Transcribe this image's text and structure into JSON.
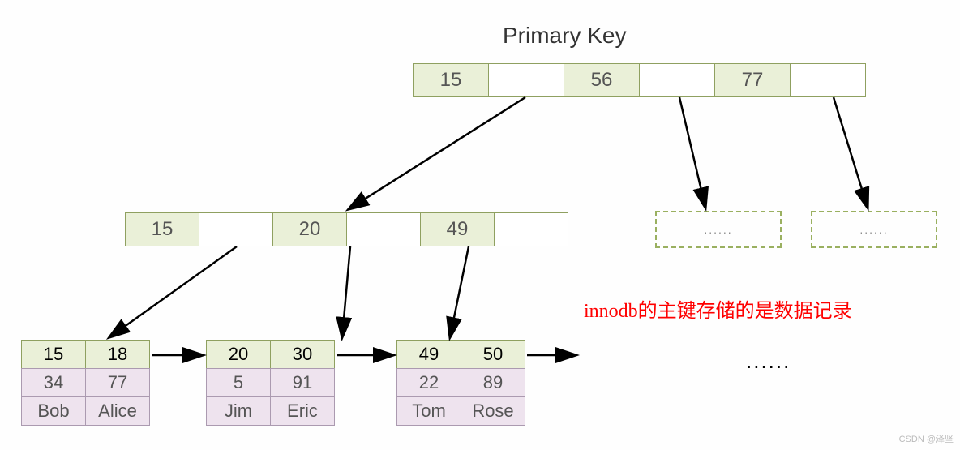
{
  "title": "Primary Key",
  "root_node": {
    "keys": [
      "15",
      "56",
      "77"
    ]
  },
  "internal_node": {
    "keys": [
      "15",
      "20",
      "49"
    ]
  },
  "dashed_placeholder": "......",
  "leaf_nodes": [
    {
      "keys": [
        "15",
        "18"
      ],
      "rows": [
        [
          "34",
          "77"
        ],
        [
          "Bob",
          "Alice"
        ]
      ]
    },
    {
      "keys": [
        "20",
        "30"
      ],
      "rows": [
        [
          "5",
          "91"
        ],
        [
          "Jim",
          "Eric"
        ]
      ]
    },
    {
      "keys": [
        "49",
        "50"
      ],
      "rows": [
        [
          "22",
          "89"
        ],
        [
          "Tom",
          "Rose"
        ]
      ]
    }
  ],
  "more_dots": "......",
  "annotation": "innodb的主键存储的是数据记录",
  "watermark": "CSDN @泽坚"
}
